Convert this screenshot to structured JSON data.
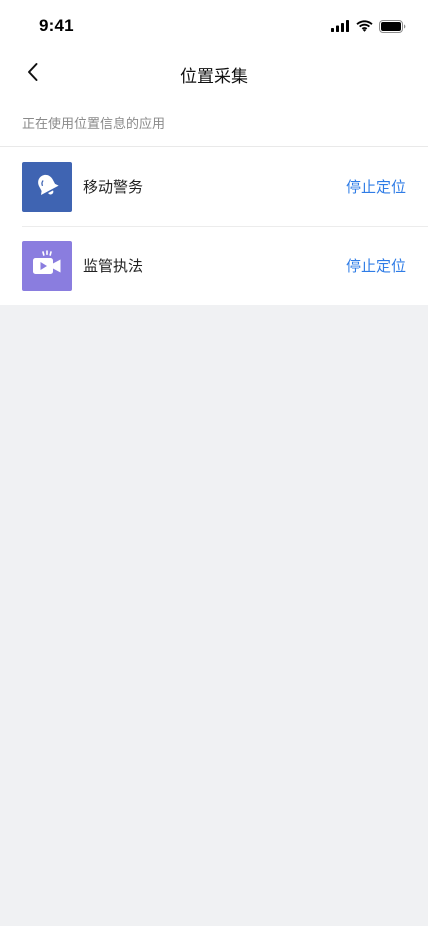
{
  "status_bar": {
    "time": "9:41",
    "icons": [
      "cellular-signal-icon",
      "wifi-icon",
      "battery-icon"
    ]
  },
  "nav": {
    "title": "位置采集",
    "back_icon": "chevron-left-icon"
  },
  "section": {
    "header": "正在使用位置信息的应用"
  },
  "apps": [
    {
      "name": "移动警务",
      "icon": "bell-icon",
      "icon_bg": "#3f64b2",
      "action_label": "停止定位"
    },
    {
      "name": "监管执法",
      "icon": "video-camera-icon",
      "icon_bg": "#8a7ddf",
      "action_label": "停止定位"
    }
  ],
  "colors": {
    "accent": "#2f7ce6",
    "background": "#f0f1f3",
    "surface": "#ffffff",
    "secondary_text": "#8a8a8a"
  }
}
